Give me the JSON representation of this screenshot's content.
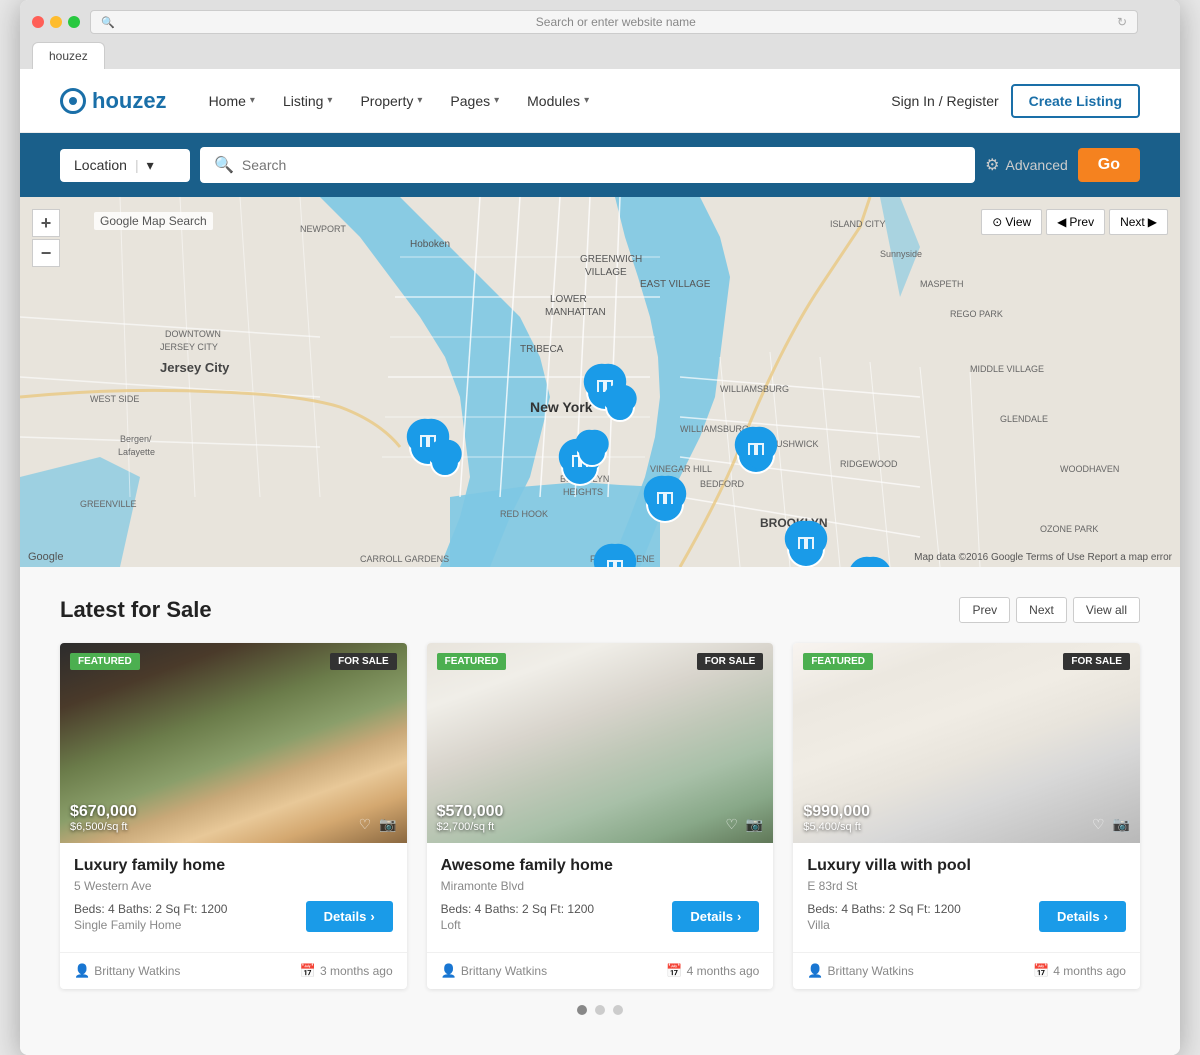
{
  "browser": {
    "url": "Search or enter website name",
    "tab": "houzez"
  },
  "nav": {
    "logo": "houzez",
    "links": [
      {
        "label": "Home",
        "hasDropdown": true
      },
      {
        "label": "Listing",
        "hasDropdown": true
      },
      {
        "label": "Property",
        "hasDropdown": true
      },
      {
        "label": "Pages",
        "hasDropdown": true
      },
      {
        "label": "Modules",
        "hasDropdown": true
      }
    ],
    "signIn": "Sign In / Register",
    "createListing": "Create Listing"
  },
  "searchBar": {
    "locationPlaceholder": "Location",
    "searchPlaceholder": "Search",
    "advancedLabel": "Advanced",
    "goLabel": "Go"
  },
  "map": {
    "searchLabel": "Google Map Search",
    "zoomIn": "+",
    "zoomOut": "−",
    "viewBtn": "View",
    "prevBtn": "Prev",
    "nextBtn": "Next",
    "attribution": "Google",
    "attribution2": "Map data ©2016 Google  Terms of Use  Report a map error",
    "cityLabel": "New York",
    "jerseyCityLabel": "Jersey City",
    "brooklynLabel": "BROOKLYN"
  },
  "listingsSection": {
    "title": "Latest for Sale",
    "prevBtn": "Prev",
    "nextBtn": "Next",
    "viewAllBtn": "View all"
  },
  "cards": [
    {
      "badge": "FEATURED",
      "saleTag": "FOR SALE",
      "price": "$670,000",
      "sqft": "$6,500/sq ft",
      "title": "Luxury family home",
      "address": "5 Western Ave",
      "specs": "Beds: 4  Baths: 2  Sq Ft: 1200",
      "type": "Single Family Home",
      "detailsBtn": "Details",
      "agent": "Brittany Watkins",
      "time": "3 months ago",
      "imgClass": "card-img-1"
    },
    {
      "badge": "FEATURED",
      "saleTag": "FOR SALE",
      "price": "$570,000",
      "sqft": "$2,700/sq ft",
      "title": "Awesome family home",
      "address": "Miramonte Blvd",
      "specs": "Beds: 4  Baths: 2  Sq Ft: 1200",
      "type": "Loft",
      "detailsBtn": "Details",
      "agent": "Brittany Watkins",
      "time": "4 months ago",
      "imgClass": "card-img-2"
    },
    {
      "badge": "FEATURED",
      "saleTag": "FOR SALE",
      "price": "$990,000",
      "sqft": "$5,400/sq ft",
      "title": "Luxury villa with pool",
      "address": "E 83rd St",
      "specs": "Beds: 4  Baths: 2  Sq Ft: 1200",
      "type": "Villa",
      "detailsBtn": "Details",
      "agent": "Brittany Watkins",
      "time": "4 months ago",
      "imgClass": "card-img-3"
    }
  ],
  "pagination": {
    "dots": [
      {
        "active": true
      },
      {
        "active": false
      },
      {
        "active": false
      }
    ]
  }
}
